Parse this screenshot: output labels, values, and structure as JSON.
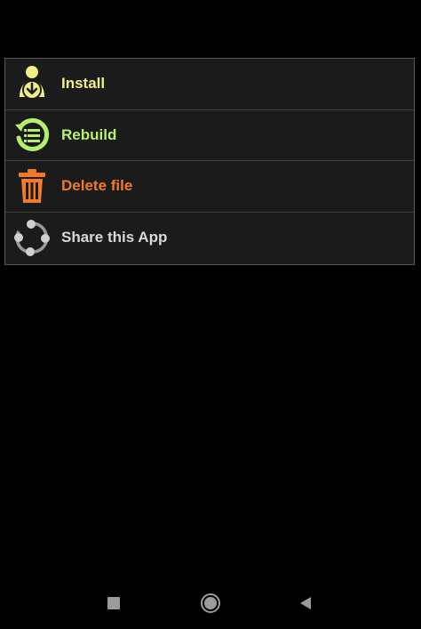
{
  "menu": {
    "items": [
      {
        "label": "Install",
        "icon": "install-icon",
        "color": "#f3ee85"
      },
      {
        "label": "Rebuild",
        "icon": "rebuild-icon",
        "color": "#b6ef6d"
      },
      {
        "label": "Delete file",
        "icon": "trash-icon",
        "color": "#f07a26"
      },
      {
        "label": "Share this App",
        "icon": "share-icon",
        "color": "#d8d8d8"
      }
    ]
  },
  "navbar": {
    "buttons": [
      "recents-button",
      "home-button",
      "back-button"
    ]
  }
}
